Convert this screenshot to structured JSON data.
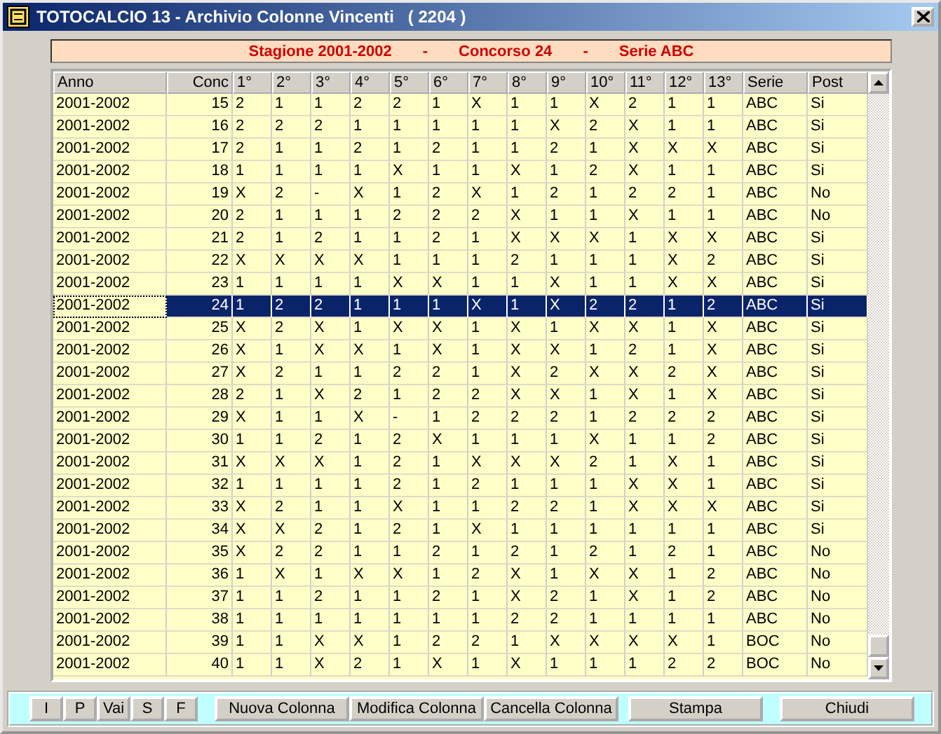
{
  "window": {
    "title": "TOTOCALCIO 13 - Archivio Colonne Vincenti   ( 2204 )"
  },
  "banner": [
    "Stagione 2001-2002",
    "-",
    "Concorso 24",
    "-",
    "Serie ABC"
  ],
  "table": {
    "columns": [
      "Anno",
      "Conc",
      "1°",
      "2°",
      "3°",
      "4°",
      "5°",
      "6°",
      "7°",
      "8°",
      "9°",
      "10°",
      "11°",
      "12°",
      "13°",
      "Serie",
      "Post"
    ],
    "rows": [
      {
        "anno": "2001-2002",
        "conc": "15",
        "picks": [
          "2",
          "1",
          "1",
          "2",
          "2",
          "1",
          "X",
          "1",
          "1",
          "X",
          "2",
          "1",
          "1"
        ],
        "serie": "ABC",
        "post": "Si",
        "selected": false
      },
      {
        "anno": "2001-2002",
        "conc": "16",
        "picks": [
          "2",
          "2",
          "2",
          "1",
          "1",
          "1",
          "1",
          "1",
          "X",
          "2",
          "X",
          "1",
          "1"
        ],
        "serie": "ABC",
        "post": "Si",
        "selected": false
      },
      {
        "anno": "2001-2002",
        "conc": "17",
        "picks": [
          "2",
          "1",
          "1",
          "2",
          "1",
          "2",
          "1",
          "1",
          "2",
          "1",
          "X",
          "X",
          "X"
        ],
        "serie": "ABC",
        "post": "Si",
        "selected": false
      },
      {
        "anno": "2001-2002",
        "conc": "18",
        "picks": [
          "1",
          "1",
          "1",
          "1",
          "X",
          "1",
          "1",
          "X",
          "1",
          "2",
          "X",
          "1",
          "1"
        ],
        "serie": "ABC",
        "post": "Si",
        "selected": false
      },
      {
        "anno": "2001-2002",
        "conc": "19",
        "picks": [
          "X",
          "2",
          "-",
          "X",
          "1",
          "2",
          "X",
          "1",
          "2",
          "1",
          "2",
          "2",
          "1"
        ],
        "serie": "ABC",
        "post": "No",
        "selected": false
      },
      {
        "anno": "2001-2002",
        "conc": "20",
        "picks": [
          "2",
          "1",
          "1",
          "1",
          "2",
          "2",
          "2",
          "X",
          "1",
          "1",
          "X",
          "1",
          "1"
        ],
        "serie": "ABC",
        "post": "No",
        "selected": false
      },
      {
        "anno": "2001-2002",
        "conc": "21",
        "picks": [
          "2",
          "1",
          "2",
          "1",
          "1",
          "2",
          "1",
          "X",
          "X",
          "X",
          "1",
          "X",
          "X"
        ],
        "serie": "ABC",
        "post": "Si",
        "selected": false
      },
      {
        "anno": "2001-2002",
        "conc": "22",
        "picks": [
          "X",
          "X",
          "X",
          "X",
          "1",
          "1",
          "1",
          "2",
          "1",
          "1",
          "1",
          "X",
          "2"
        ],
        "serie": "ABC",
        "post": "Si",
        "selected": false
      },
      {
        "anno": "2001-2002",
        "conc": "23",
        "picks": [
          "1",
          "1",
          "1",
          "1",
          "X",
          "X",
          "1",
          "1",
          "X",
          "1",
          "1",
          "X",
          "X"
        ],
        "serie": "ABC",
        "post": "Si",
        "selected": false
      },
      {
        "anno": "2001-2002",
        "conc": "24",
        "picks": [
          "1",
          "2",
          "2",
          "1",
          "1",
          "1",
          "X",
          "1",
          "X",
          "2",
          "2",
          "1",
          "2"
        ],
        "serie": "ABC",
        "post": "Si",
        "selected": true
      },
      {
        "anno": "2001-2002",
        "conc": "25",
        "picks": [
          "X",
          "2",
          "X",
          "1",
          "X",
          "X",
          "1",
          "X",
          "1",
          "X",
          "X",
          "1",
          "X"
        ],
        "serie": "ABC",
        "post": "Si",
        "selected": false
      },
      {
        "anno": "2001-2002",
        "conc": "26",
        "picks": [
          "X",
          "1",
          "X",
          "X",
          "1",
          "X",
          "1",
          "X",
          "X",
          "1",
          "2",
          "1",
          "X"
        ],
        "serie": "ABC",
        "post": "Si",
        "selected": false
      },
      {
        "anno": "2001-2002",
        "conc": "27",
        "picks": [
          "X",
          "2",
          "1",
          "1",
          "2",
          "2",
          "1",
          "X",
          "2",
          "X",
          "X",
          "2",
          "X"
        ],
        "serie": "ABC",
        "post": "Si",
        "selected": false
      },
      {
        "anno": "2001-2002",
        "conc": "28",
        "picks": [
          "2",
          "1",
          "X",
          "2",
          "1",
          "2",
          "2",
          "X",
          "X",
          "1",
          "X",
          "1",
          "X"
        ],
        "serie": "ABC",
        "post": "Si",
        "selected": false
      },
      {
        "anno": "2001-2002",
        "conc": "29",
        "picks": [
          "X",
          "1",
          "1",
          "X",
          "-",
          "1",
          "2",
          "2",
          "2",
          "1",
          "2",
          "2",
          "2"
        ],
        "serie": "ABC",
        "post": "Si",
        "selected": false
      },
      {
        "anno": "2001-2002",
        "conc": "30",
        "picks": [
          "1",
          "1",
          "2",
          "1",
          "2",
          "X",
          "1",
          "1",
          "1",
          "X",
          "1",
          "1",
          "2"
        ],
        "serie": "ABC",
        "post": "Si",
        "selected": false
      },
      {
        "anno": "2001-2002",
        "conc": "31",
        "picks": [
          "X",
          "X",
          "X",
          "1",
          "2",
          "1",
          "X",
          "X",
          "X",
          "2",
          "1",
          "X",
          "1"
        ],
        "serie": "ABC",
        "post": "Si",
        "selected": false
      },
      {
        "anno": "2001-2002",
        "conc": "32",
        "picks": [
          "1",
          "1",
          "1",
          "1",
          "2",
          "1",
          "2",
          "1",
          "1",
          "1",
          "X",
          "X",
          "1"
        ],
        "serie": "ABC",
        "post": "Si",
        "selected": false
      },
      {
        "anno": "2001-2002",
        "conc": "33",
        "picks": [
          "X",
          "2",
          "1",
          "1",
          "X",
          "1",
          "1",
          "2",
          "2",
          "1",
          "X",
          "X",
          "X"
        ],
        "serie": "ABC",
        "post": "Si",
        "selected": false
      },
      {
        "anno": "2001-2002",
        "conc": "34",
        "picks": [
          "X",
          "X",
          "2",
          "1",
          "2",
          "1",
          "X",
          "1",
          "1",
          "1",
          "1",
          "1",
          "1"
        ],
        "serie": "ABC",
        "post": "Si",
        "selected": false
      },
      {
        "anno": "2001-2002",
        "conc": "35",
        "picks": [
          "X",
          "2",
          "2",
          "1",
          "1",
          "2",
          "1",
          "2",
          "1",
          "2",
          "1",
          "2",
          "1"
        ],
        "serie": "ABC",
        "post": "No",
        "selected": false
      },
      {
        "anno": "2001-2002",
        "conc": "36",
        "picks": [
          "1",
          "X",
          "1",
          "X",
          "X",
          "1",
          "2",
          "X",
          "1",
          "X",
          "X",
          "1",
          "2"
        ],
        "serie": "ABC",
        "post": "No",
        "selected": false
      },
      {
        "anno": "2001-2002",
        "conc": "37",
        "picks": [
          "1",
          "1",
          "2",
          "1",
          "1",
          "2",
          "1",
          "X",
          "2",
          "1",
          "X",
          "1",
          "2"
        ],
        "serie": "ABC",
        "post": "No",
        "selected": false
      },
      {
        "anno": "2001-2002",
        "conc": "38",
        "picks": [
          "1",
          "1",
          "1",
          "1",
          "1",
          "1",
          "1",
          "2",
          "2",
          "1",
          "1",
          "1",
          "1"
        ],
        "serie": "ABC",
        "post": "No",
        "selected": false
      },
      {
        "anno": "2001-2002",
        "conc": "39",
        "picks": [
          "1",
          "1",
          "X",
          "X",
          "1",
          "2",
          "2",
          "1",
          "X",
          "X",
          "X",
          "X",
          "1"
        ],
        "serie": "BOC",
        "post": "No",
        "selected": false
      },
      {
        "anno": "2001-2002",
        "conc": "40",
        "picks": [
          "1",
          "1",
          "X",
          "2",
          "1",
          "X",
          "1",
          "X",
          "1",
          "1",
          "1",
          "2",
          "2"
        ],
        "serie": "BOC",
        "post": "No",
        "selected": false
      }
    ]
  },
  "nav_buttons": [
    "I",
    "P",
    "Vai",
    "S",
    "F"
  ],
  "action_buttons": [
    "Nuova Colonna",
    "Modifica Colonna",
    "Cancella Colonna"
  ],
  "print_button": "Stampa",
  "close_button": "Chiudi"
}
